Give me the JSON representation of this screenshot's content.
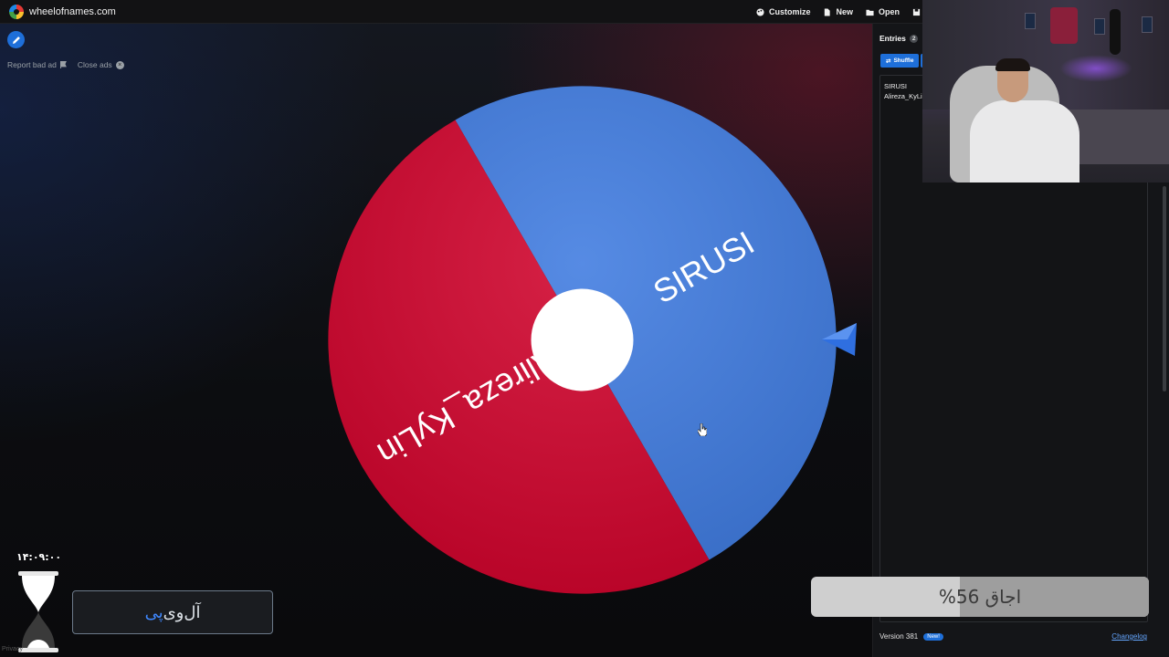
{
  "topbar": {
    "site": "wheelofnames.com",
    "menu": [
      {
        "label": "Customize",
        "icon": "palette-icon"
      },
      {
        "label": "New",
        "icon": "file-icon"
      },
      {
        "label": "Open",
        "icon": "folder-icon"
      }
    ]
  },
  "ads": {
    "report": "Report bad ad",
    "close": "Close ads"
  },
  "wheel": {
    "segments": [
      {
        "label": "SIRUSI",
        "color": "#3f7be0"
      },
      {
        "label": "Alireza_KyLin",
        "color": "#d0032c"
      }
    ],
    "center_color": "#ffffff",
    "pointer_color": "#2f6fe0"
  },
  "panel": {
    "tab_entries": "Entries",
    "count": "2",
    "shuffle": "Shuffle",
    "entries": [
      "SIRUSI",
      "Alireza_KyLin"
    ],
    "version": "Version 381",
    "new_badge": "New!",
    "changelog": "Changelog"
  },
  "overlay": {
    "clock": "۱۴:۰۹:۰۰",
    "name_part1": "آل‌وی",
    "name_part2": "پی",
    "progress_label": "اجاق 56%",
    "progress_value": 0.56,
    "privacy": "Privacy"
  }
}
